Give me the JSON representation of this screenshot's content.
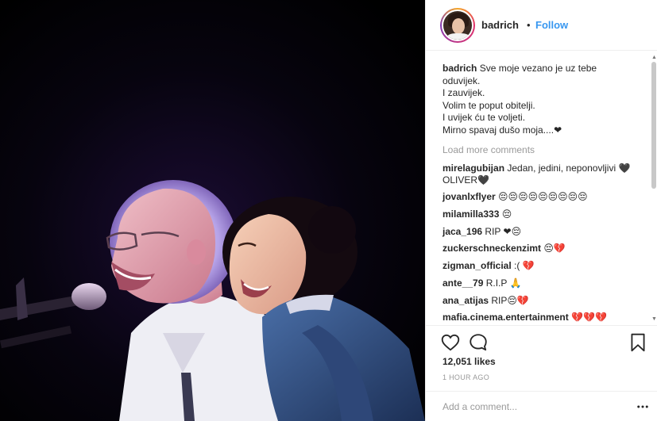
{
  "post": {
    "image_alt": "Two singers laughing on stage beside a microphone",
    "colors": {
      "accent": "#3897f0",
      "heart_red": "#b1121c",
      "muted": "#999999"
    }
  },
  "header": {
    "username": "badrich",
    "separator": "•",
    "follow_label": "Follow",
    "avatar_icon": "profile-avatar"
  },
  "caption": {
    "username": "badrich",
    "lines": [
      "Sve moje vezano je uz tebe",
      "oduvijek.",
      "I zauvijek.",
      "Volim te poput obitelji.",
      "I uvijek ću te voljeti.",
      "Mirno spavaj dušo moja....❤"
    ]
  },
  "load_more_label": "Load more comments",
  "comments": [
    {
      "user": "mirelagubijan",
      "text": "Jedan, jedini, neponovljivi 🖤 OLIVER🖤"
    },
    {
      "user": "jovanlxflyer",
      "text": "😔😔😔😔😔😔😔😔😔"
    },
    {
      "user": "milamilla333",
      "text": "😔"
    },
    {
      "user": "jaca_196",
      "text": "RIP ❤😔"
    },
    {
      "user": "zuckerschneckenzimt",
      "text": "😔💔"
    },
    {
      "user": "zigman_official",
      "text": ":( 💔"
    },
    {
      "user": "ante__79",
      "text": "R.I.P 🙏"
    },
    {
      "user": "ana_atijas",
      "text": "RIP😔💔"
    },
    {
      "user": "mafia.cinema.entertainment",
      "text": "💔💔💔"
    }
  ],
  "actions": {
    "like_icon": "heart-outline-icon",
    "comment_icon": "comment-bubble-icon",
    "save_icon": "bookmark-icon"
  },
  "likes_label": "12,051 likes",
  "timestamp": "1 HOUR AGO",
  "add_comment": {
    "placeholder": "Add a comment...",
    "more_icon": "more-options-icon"
  }
}
